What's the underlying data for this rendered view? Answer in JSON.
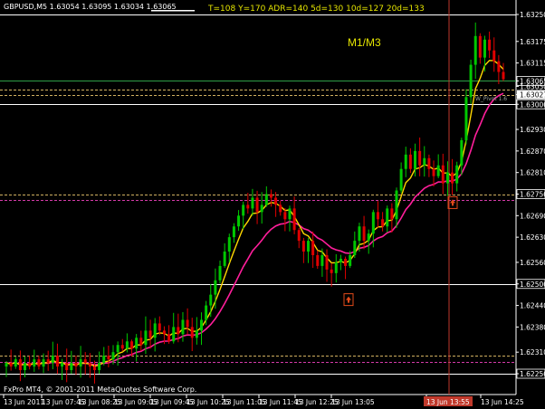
{
  "symbol_header": "GBPUSD,M5  1.63054 1.63095 1.63034 1.63065",
  "indicator_stats": "T=108  Y=170  ADR=140  5d=130  10d=127  20d=133",
  "timeframe_label": "M1/M3",
  "pivot_label": "W_Pivot 1.6",
  "copyright": "FxPro MT4, © 2001-2011 MetaQuotes Software Corp.",
  "highlight_price": "1.63027",
  "highlight_time": "13 Jun 13:55",
  "colors": {
    "background": "#000000",
    "bull": "#00c800",
    "bear": "#e00000",
    "fast_ma": "#ffd700",
    "slow_ma": "#ff1e9b",
    "grid_line": "#ffffff",
    "level_green": "#2e9e47",
    "level_dashed": "#d0b060",
    "level_magenta": "#d43aa8",
    "time_marker": "#c0392b",
    "arrow_box": "#e24a1a"
  },
  "price_axis": {
    "labels": [
      "1.63250",
      "1.63175",
      "1.63115",
      "1.63065",
      "1.63050",
      "1.63027",
      "1.63000",
      "1.62930",
      "1.62870",
      "1.62810",
      "1.62750",
      "1.62690",
      "1.62630",
      "1.62560",
      "1.62500",
      "1.62440",
      "1.62380",
      "1.62310",
      "1.62250"
    ],
    "highlighted": [
      "1.63065",
      "1.63027",
      "1.63000",
      "1.62750",
      "1.62500",
      "1.62250"
    ]
  },
  "time_axis": {
    "labels": [
      "13 Jun 2011",
      "13 Jun 07:45",
      "13 Jun 08:25",
      "13 Jun 09:05",
      "13 Jun 09:45",
      "13 Jun 10:25",
      "13 Jun 11:05",
      "13 Jun 11:45",
      "13 Jun 12:25",
      "13 Jun 13:05",
      "13 Jun 13:55",
      "13 Jun 14:25"
    ]
  },
  "arrow_markers": [
    {
      "time": "13 Jun 12:05",
      "price": 1.62455,
      "direction": "up"
    },
    {
      "time": "13 Jun 13:25",
      "price": 1.62725,
      "direction": "up"
    }
  ],
  "horizontal_levels": [
    {
      "price": 1.6325,
      "style": "solid",
      "color": "white"
    },
    {
      "price": 1.63065,
      "style": "solid",
      "color": "green"
    },
    {
      "price": 1.63042,
      "style": "dashed",
      "color": "gold"
    },
    {
      "price": 1.63027,
      "style": "dashed",
      "color": "gold"
    },
    {
      "price": 1.63,
      "style": "solid",
      "color": "white"
    },
    {
      "price": 1.6275,
      "style": "dashed",
      "color": "gold"
    },
    {
      "price": 1.62733,
      "style": "dashed",
      "color": "magenta"
    },
    {
      "price": 1.625,
      "style": "solid",
      "color": "white"
    },
    {
      "price": 1.623,
      "style": "dashed",
      "color": "gold"
    },
    {
      "price": 1.62283,
      "style": "dashed",
      "color": "magenta"
    },
    {
      "price": 1.6225,
      "style": "solid",
      "color": "white"
    }
  ],
  "chart_data": {
    "type": "candlestick",
    "symbol": "GBPUSD",
    "timeframe": "M5",
    "ylim": [
      1.622,
      1.6327
    ],
    "closes": [
      1.6228,
      1.6227,
      1.6229,
      1.6226,
      1.6228,
      1.6227,
      1.6229,
      1.6227,
      1.6229,
      1.6228,
      1.623,
      1.6227,
      1.6228,
      1.6226,
      1.6228,
      1.6227,
      1.6229,
      1.6228,
      1.6227,
      1.6226,
      1.6228,
      1.623,
      1.6229,
      1.6231,
      1.6233,
      1.6232,
      1.6234,
      1.6232,
      1.6235,
      1.6233,
      1.6237,
      1.6235,
      1.6239,
      1.6237,
      1.6236,
      1.6234,
      1.6238,
      1.6236,
      1.624,
      1.6238,
      1.6235,
      1.6237,
      1.624,
      1.6244,
      1.6247,
      1.6251,
      1.6255,
      1.6259,
      1.6263,
      1.6266,
      1.6269,
      1.6272,
      1.6271,
      1.6274,
      1.627,
      1.6272,
      1.6275,
      1.6274,
      1.6272,
      1.627,
      1.6268,
      1.6271,
      1.6265,
      1.6262,
      1.6259,
      1.6262,
      1.6258,
      1.6255,
      1.6258,
      1.6254,
      1.6253,
      1.6256,
      1.6257,
      1.6255,
      1.6258,
      1.6262,
      1.6266,
      1.6262,
      1.6264,
      1.627,
      1.6268,
      1.6266,
      1.6271,
      1.6268,
      1.6276,
      1.6282,
      1.6286,
      1.6282,
      1.6287,
      1.6283,
      1.6285,
      1.6282,
      1.628,
      1.6283,
      1.6278,
      1.6281,
      1.6278,
      1.6283,
      1.629,
      1.6302,
      1.6311,
      1.6319,
      1.6313,
      1.6318,
      1.6315,
      1.6312,
      1.6309,
      1.6307
    ]
  }
}
